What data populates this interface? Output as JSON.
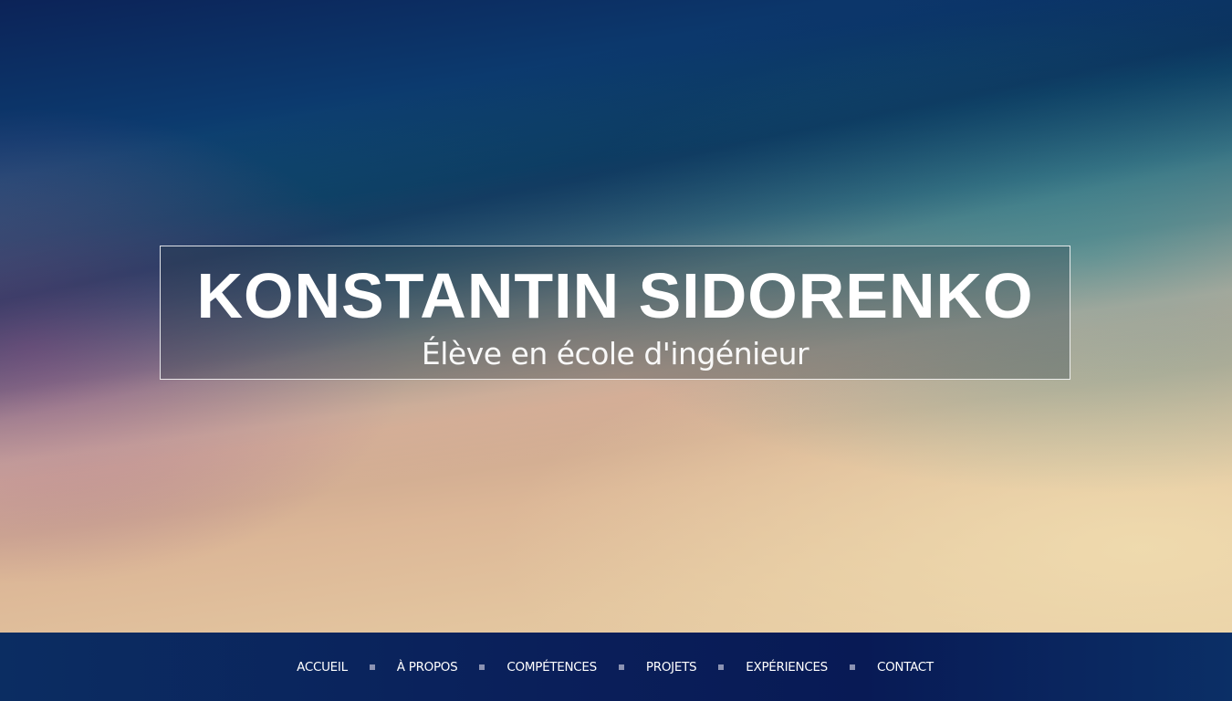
{
  "hero": {
    "title": "KONSTANTIN SIDORENKO",
    "subtitle": "Élève en école d'ingénieur"
  },
  "nav": {
    "items": [
      {
        "label": "ACCUEIL"
      },
      {
        "label": "À PROPOS"
      },
      {
        "label": "COMPÉTENCES"
      },
      {
        "label": "PROJETS"
      },
      {
        "label": "EXPÉRIENCES"
      },
      {
        "label": "CONTACT"
      }
    ],
    "separator_icon": "square-bullet-icon"
  },
  "colors": {
    "nav_background": "#0a1f5a",
    "separator": "#8c93b3",
    "text": "#ffffff"
  }
}
